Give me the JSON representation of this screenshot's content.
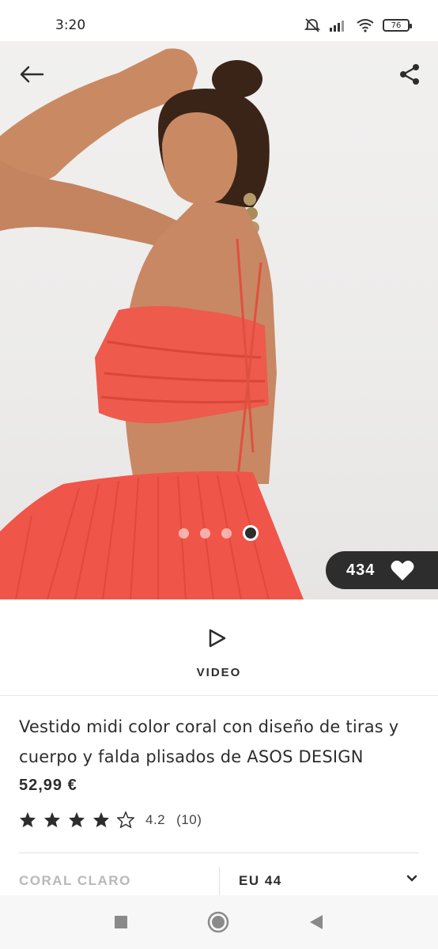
{
  "status_bar": {
    "time": "3:20",
    "battery": "76"
  },
  "hero": {
    "likes": "434",
    "dots_count": 4,
    "active_dot": 3
  },
  "video": {
    "label": "VIDEO"
  },
  "product": {
    "title": "Vestido midi color coral con diseño de tiras y cuerpo y falda plisados de ASOS DESIGN",
    "price": "52,99 €",
    "rating_value": "4.2",
    "rating_count": "(10)",
    "stars": 4.2
  },
  "options": {
    "color": "CORAL CLARO",
    "size": "EU 44"
  },
  "colors": {
    "text": "#2d2d2d",
    "dress": "#f0554a",
    "muted": "#b8b8b8"
  },
  "icons": [
    "back-arrow-icon",
    "share-icon",
    "heart-icon",
    "play-icon",
    "star-icon",
    "chevron-down-icon"
  ]
}
